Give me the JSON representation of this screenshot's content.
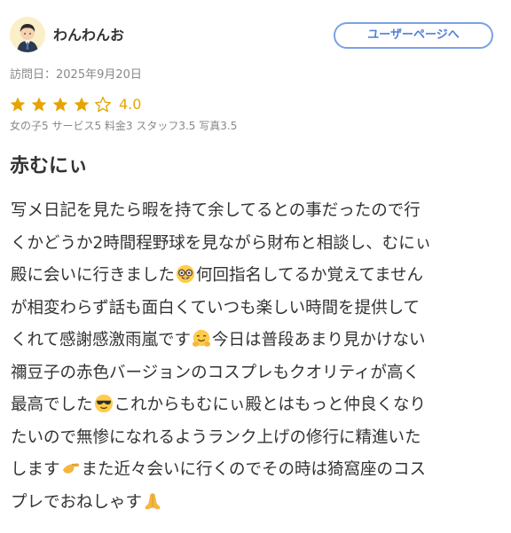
{
  "header": {
    "username": "わんわんお",
    "user_page_button": "ユーザーページへ"
  },
  "visit": {
    "date_text": "訪問日：2025年9月20日"
  },
  "rating": {
    "value": "4.0",
    "stars_filled": 4,
    "stars_total": 5,
    "star_color": "#e6a400",
    "sub_scores": "女の子5 サービス5 料金3 スタッフ3.5 写真3.5"
  },
  "review": {
    "title": "赤むにぃ",
    "lines": [
      {
        "parts": [
          "写メ日記を見たら暇を持て余してるとの事だったので行"
        ]
      },
      {
        "parts": [
          "くかどうか2時間程野球を見ながら財布と相談し、むにぃ"
        ]
      },
      {
        "parts": [
          "殿に会いに行きました",
          "何回指名してるか覚えてません"
        ]
      },
      {
        "parts": [
          "が相変わらず話も面白くていつも楽しい時間を提供して"
        ]
      },
      {
        "parts": [
          "くれて感謝感激雨嵐です",
          "今日は普段あまり見かけない"
        ]
      },
      {
        "parts": [
          "禰豆子の赤色バージョンのコスプレもクオリティが高く"
        ]
      },
      {
        "parts": [
          "最高でした",
          "これからもむにぃ殿とはもっと仲良くなり"
        ]
      },
      {
        "parts": [
          "たいので無惨になれるようランク上げの修行に精進いた"
        ]
      },
      {
        "parts": [
          "します",
          "また近々会いに行くのでその時は猗窩座のコス"
        ]
      },
      {
        "parts": [
          "プレでおねしゃす",
          ""
        ]
      }
    ],
    "emoji_names": [
      "nerd-face-emoji",
      "hugging-face-emoji",
      "sunglasses-face-emoji",
      "saluting-hand-emoji",
      "folded-hands-emoji"
    ]
  },
  "colors": {
    "accent_blue": "#4f7fd6",
    "button_border": "#7aa1e6",
    "text": "#333333",
    "muted": "#888888"
  }
}
